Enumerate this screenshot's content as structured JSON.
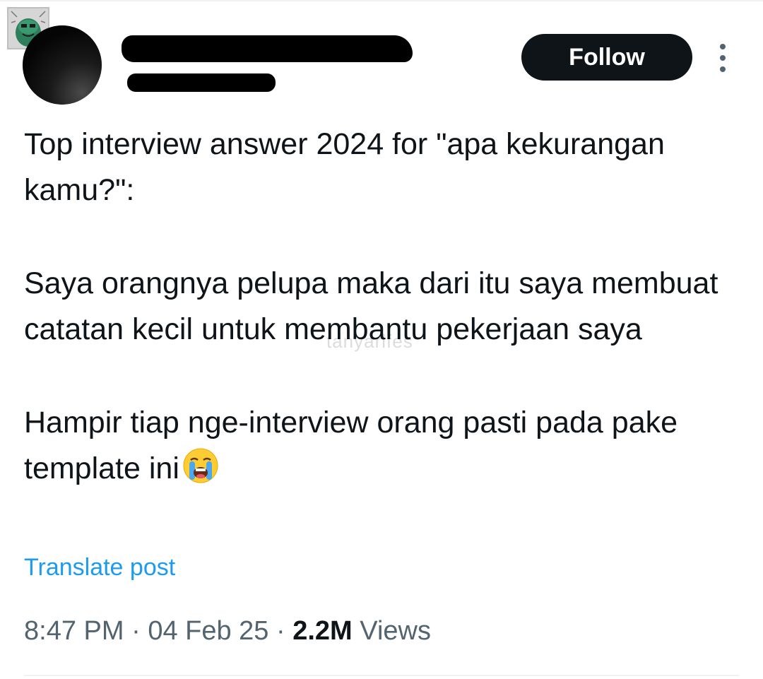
{
  "header": {
    "follow_label": "Follow"
  },
  "tweet": {
    "paragraphs": [
      "Top interview answer 2024 for \"apa kekurangan kamu?\":",
      "Saya orangnya pelupa maka dari itu saya membuat catatan kecil untuk membantu pekerjaan saya",
      "Hampir tiap nge-interview orang pasti pada pake template ini"
    ],
    "emoji": "loudly-crying-face",
    "watermark": "tanyarlfes"
  },
  "translate_label": "Translate post",
  "meta": {
    "time": "8:47 PM",
    "separator": "·",
    "date": "04 Feb 25",
    "views_count": "2.2M",
    "views_label": "Views"
  },
  "colors": {
    "follow_bg": "#0f1419",
    "link": "#1d9bf0",
    "secondary_text": "#536471"
  }
}
